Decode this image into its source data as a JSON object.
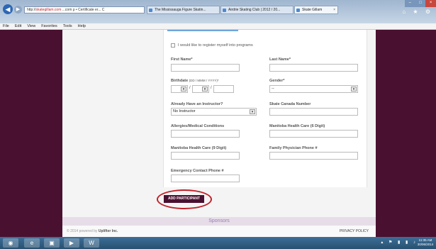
{
  "browser": {
    "address_prefix": "http://",
    "address_domain": "skategillam.com",
    "address_suffix": " ...com  ρ •  Certificate er...  C",
    "tabs": [
      {
        "label": "The Mississauga Figure Skatin..."
      },
      {
        "label": "Airdrie Skating Club | 2012 / 20..."
      },
      {
        "label": "Skate Gillam",
        "close": "×"
      }
    ],
    "window_buttons": [
      "–",
      "□",
      "×"
    ],
    "toolbar_icons": "⌂ ★ ⚙"
  },
  "menu": [
    "File",
    "Edit",
    "View",
    "Favorites",
    "Tools",
    "Help"
  ],
  "form": {
    "register_myself": "I would like to register myself into programs",
    "first_name_label": "First Name*",
    "last_name_label": "Last Name*",
    "birthdate_label": "Birthdate",
    "birthdate_hint": "(DD / MMM / YYYY)*",
    "birthdate_sep": "/",
    "gender_label": "Gender*",
    "gender_value": "--",
    "instructor_label": "Already Have an Instructor?",
    "instructor_value": "No Instructor",
    "skate_canada_label": "Skate Canada Number",
    "allergies_label": "Allergies/Medical Conditions",
    "manitoba6_label": "Manitoba Health Care (6 Digit)",
    "manitoba9_label": "Manitoba Health Care (9 Digit)",
    "physician_label": "Family Physician Phone #",
    "emergency_label": "Emergency Contact Phone #",
    "add_button": "ADD PARTICIPANT"
  },
  "dropdown_arrow": "▾",
  "sponsors": "Sponsors",
  "footer": {
    "copy_prefix": "© 2014 powered by ",
    "copy_brand": "Uplifter Inc.",
    "privacy": "PRIVACY POLICY"
  },
  "taskbar": {
    "apps": [
      "◉",
      "e",
      "▣",
      "▶",
      "W"
    ],
    "tray": "▴ ⚑ ▮ ▮ ♪",
    "time": "11:35 AM",
    "date": "30/06/2014"
  },
  "colors": {
    "brand": "#4a1030",
    "highlight_circle": "#c21f28",
    "sponsors_text": "#9b7db4"
  }
}
